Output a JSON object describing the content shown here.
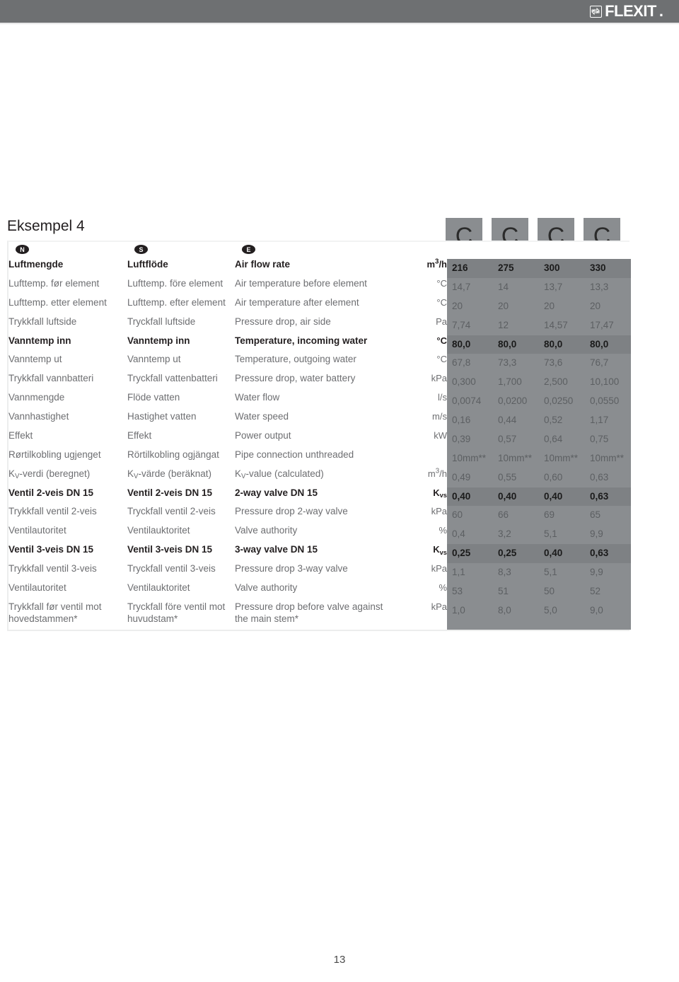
{
  "header": {
    "brand": "FLEXIT",
    "brand_dot": ".",
    "logo_icon": "flexit-exchange-icon"
  },
  "example": {
    "title": "Eksempel 4"
  },
  "series_boxes": [
    {
      "label": "C"
    },
    {
      "label": "C"
    },
    {
      "label": "C"
    },
    {
      "label": "C"
    }
  ],
  "language_badges": [
    {
      "code": "N"
    },
    {
      "code": "S"
    },
    {
      "code": "E"
    }
  ],
  "table": {
    "rows": [
      {
        "style": "hdr",
        "no": "Luftmengde",
        "se": "Luftflöde",
        "en": "Air flow rate",
        "unit": "m³/h",
        "unit_html": "m<span class=\"sup3\">3</span>/h",
        "values": [
          "216",
          "275",
          "300",
          "330"
        ]
      },
      {
        "style": "normal",
        "no": "Lufttemp. før element",
        "se": "Lufttemp. före element",
        "en": "Air temperature before element",
        "unit": "°C",
        "values": [
          "14,7",
          "14",
          "13,7",
          "13,3"
        ]
      },
      {
        "style": "normal",
        "no": "Lufttemp. etter element",
        "se": "Lufttemp. efter element",
        "en": "Air temperature after element",
        "unit": "°C",
        "values": [
          "20",
          "20",
          "20",
          "20"
        ]
      },
      {
        "style": "normal",
        "no": "Trykkfall luftside",
        "se": "Tryckfall luftside",
        "en": "Pressure drop, air side",
        "unit": "Pa",
        "values": [
          "7,74",
          "12",
          "14,57",
          "17,47"
        ]
      },
      {
        "style": "bold-row",
        "no": "Vanntemp inn",
        "se": "Vanntemp inn",
        "en": "Temperature, incoming water",
        "unit": "°C",
        "values": [
          "80,0",
          "80,0",
          "80,0",
          "80,0"
        ]
      },
      {
        "style": "normal",
        "no": "Vanntemp ut",
        "se": "Vanntemp ut",
        "en": "Temperature, outgoing water",
        "unit": "°C",
        "values": [
          "67,8",
          "73,3",
          "73,6",
          "76,7"
        ]
      },
      {
        "style": "normal",
        "no": "Trykkfall vannbatteri",
        "se": "Tryckfall vattenbatteri",
        "en": "Pressure drop, water battery",
        "unit": "kPa",
        "values": [
          "0,300",
          "1,700",
          "2,500",
          "10,100"
        ]
      },
      {
        "style": "normal",
        "no": "Vannmengde",
        "se": "Flöde vatten",
        "en": "Water flow",
        "unit": "l/s",
        "values": [
          "0,0074",
          "0,0200",
          "0,0250",
          "0,0550"
        ]
      },
      {
        "style": "normal",
        "no": "Vannhastighet",
        "se": "Hastighet vatten",
        "en": "Water speed",
        "unit": "m/s",
        "values": [
          "0,16",
          "0,44",
          "0,52",
          "1,17"
        ]
      },
      {
        "style": "normal",
        "no": "Effekt",
        "se": "Effekt",
        "en": "Power output",
        "unit": "kW",
        "values": [
          "0,39",
          "0,57",
          "0,64",
          "0,75"
        ]
      },
      {
        "style": "normal",
        "no": "Rørtilkobling ugjenget",
        "se": "Rörtilkobling ogjängat",
        "en": "Pipe connection unthreaded",
        "unit": "",
        "values": [
          "10mm**",
          "10mm**",
          "10mm**",
          "10mm**"
        ]
      },
      {
        "style": "normal",
        "no": "K_V-verdi (beregnet)",
        "no_html": "K<sub>V</sub>-verdi (beregnet)",
        "se": "K_V-värde (beräknat)",
        "se_html": "K<sub>V</sub>-värde (beräknat)",
        "en": "K_V-value (calculated)",
        "en_html": "K<sub>V</sub>-value (calculated)",
        "unit": "m³/h",
        "unit_html": "m<span class=\"sup3\">3</span>/h",
        "values": [
          "0,49",
          "0,55",
          "0,60",
          "0,63"
        ]
      },
      {
        "style": "bold-row",
        "no": "Ventil 2-veis DN 15",
        "se": "Ventil 2-veis DN 15",
        "en": "2-way valve DN 15",
        "unit": "K_vs",
        "unit_html": "K<sub>vs</sub>",
        "values": [
          "0,40",
          "0,40",
          "0,40",
          "0,63"
        ]
      },
      {
        "style": "normal",
        "no": "Trykkfall ventil 2-veis",
        "se": "Tryckfall ventil 2-veis",
        "en": "Pressure drop 2-way valve",
        "unit": "kPa",
        "values": [
          "60",
          "66",
          "69",
          "65"
        ]
      },
      {
        "style": "normal",
        "no": "Ventilautoritet",
        "se": "Ventilauktoritet",
        "en": "Valve authority",
        "unit": "%",
        "values": [
          "0,4",
          "3,2",
          "5,1",
          "9,9"
        ]
      },
      {
        "style": "bold-row",
        "no": "Ventil 3-veis DN 15",
        "se": "Ventil 3-veis DN 15",
        "en": "3-way valve DN 15",
        "unit": "K_vs",
        "unit_html": "K<sub>vs</sub>",
        "values": [
          "0,25",
          "0,25",
          "0,40",
          "0,63"
        ]
      },
      {
        "style": "normal",
        "no": "Trykkfall ventil 3-veis",
        "se": "Tryckfall ventil 3-veis",
        "en": "Pressure drop 3-way valve",
        "unit": "kPa",
        "values": [
          "1,1",
          "8,3",
          "5,1",
          "9,9"
        ]
      },
      {
        "style": "normal",
        "no": "Ventilautoritet",
        "se": "Ventilauktoritet",
        "en": "Valve authority",
        "unit": "%",
        "values": [
          "53",
          "51",
          "50",
          "52"
        ]
      },
      {
        "style": "tall",
        "no": "Trykkfall før ventil mot hovedstammen*",
        "se": "Tryckfall före ventil mot huvudstam*",
        "en": "Pressure drop before valve against the main stem*",
        "unit": "kPa",
        "values": [
          "1,0",
          "8,0",
          "5,0",
          "9,0"
        ]
      }
    ]
  },
  "footer": {
    "page_number": "13"
  },
  "colors": {
    "header_bar": "#6e7072",
    "cell_value": "#8a8d90",
    "cell_header": "#7e8184",
    "text_muted": "#6d6e71",
    "text_dark": "#231f20"
  }
}
